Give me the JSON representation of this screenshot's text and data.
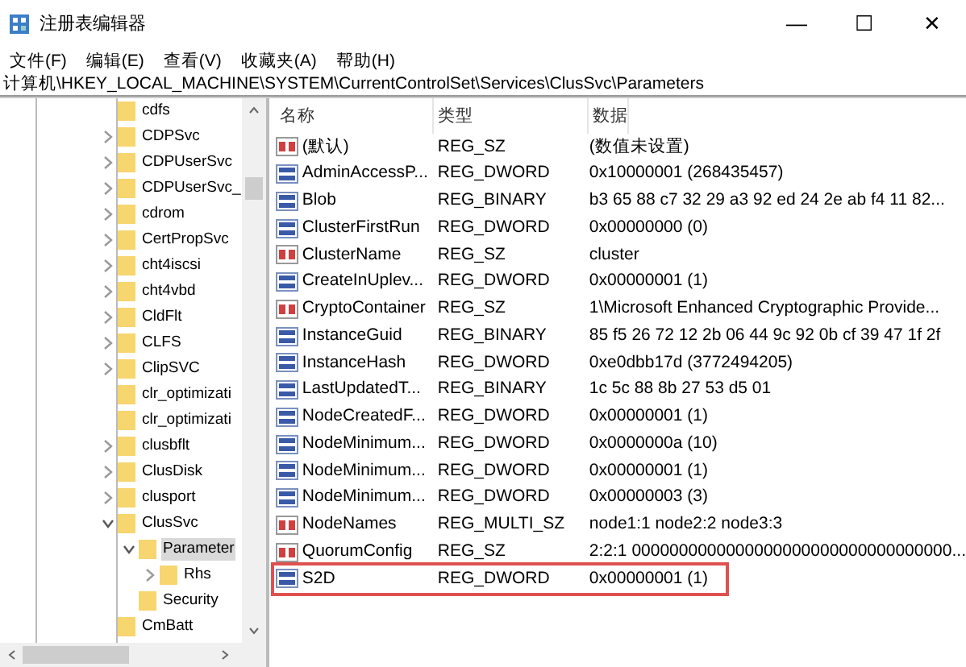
{
  "window": {
    "title": "注册表编辑器",
    "controls": [
      "—",
      "☐",
      "✕"
    ]
  },
  "menu": [
    "文件(F)",
    "编辑(E)",
    "查看(V)",
    "收藏夹(A)",
    "帮助(H)"
  ],
  "address": "计算机\\HKEY_LOCAL_MACHINE\\SYSTEM\\CurrentControlSet\\Services\\ClusSvc\\Parameters",
  "tree": [
    {
      "label": "cdfs",
      "expandable": false,
      "selected": false
    },
    {
      "label": "CDPSvc",
      "expandable": true,
      "expanded": false,
      "selected": false
    },
    {
      "label": "CDPUserSvc",
      "expandable": true,
      "expanded": false,
      "selected": false
    },
    {
      "label": "CDPUserSvc_",
      "expandable": true,
      "expanded": false,
      "selected": false
    },
    {
      "label": "cdrom",
      "expandable": true,
      "expanded": false,
      "selected": false
    },
    {
      "label": "CertPropSvc",
      "expandable": true,
      "expanded": false,
      "selected": false
    },
    {
      "label": "cht4iscsi",
      "expandable": true,
      "expanded": false,
      "selected": false
    },
    {
      "label": "cht4vbd",
      "expandable": true,
      "expanded": false,
      "selected": false
    },
    {
      "label": "CldFlt",
      "expandable": true,
      "expanded": false,
      "selected": false
    },
    {
      "label": "CLFS",
      "expandable": true,
      "expanded": false,
      "selected": false
    },
    {
      "label": "ClipSVC",
      "expandable": true,
      "expanded": false,
      "selected": false
    },
    {
      "label": "clr_optimizati",
      "expandable": false,
      "selected": false
    },
    {
      "label": "clr_optimizati",
      "expandable": false,
      "selected": false
    },
    {
      "label": "clusbflt",
      "expandable": true,
      "expanded": false,
      "selected": false
    },
    {
      "label": "ClusDisk",
      "expandable": true,
      "expanded": false,
      "selected": false
    },
    {
      "label": "clusport",
      "expandable": true,
      "expanded": false,
      "selected": false
    },
    {
      "label": "ClusSvc",
      "expandable": true,
      "expanded": true,
      "selected": false,
      "children": [
        {
          "label": "Parameter",
          "expandable": true,
          "expanded": true,
          "selected": true,
          "children": [
            {
              "label": "Rhs",
              "expandable": true,
              "expanded": false,
              "selected": false
            }
          ]
        },
        {
          "label": "Security",
          "expandable": false,
          "selected": false
        }
      ]
    },
    {
      "label": "CmBatt",
      "expandable": false,
      "selected": false
    }
  ],
  "columns": [
    "名称",
    "类型",
    "数据"
  ],
  "values": [
    {
      "kind": "string",
      "name": "(默认)",
      "type": "REG_SZ",
      "data": "(数值未设置)",
      "highlighted": false
    },
    {
      "kind": "binary",
      "name": "AdminAccessP...",
      "type": "REG_DWORD",
      "data": "0x10000001 (268435457)",
      "highlighted": false
    },
    {
      "kind": "binary",
      "name": "Blob",
      "type": "REG_BINARY",
      "data": "b3 65 88 c7 32 29 a3 92 ed 24 2e ab f4 11 82...",
      "highlighted": false
    },
    {
      "kind": "binary",
      "name": "ClusterFirstRun",
      "type": "REG_DWORD",
      "data": "0x00000000 (0)",
      "highlighted": false
    },
    {
      "kind": "string",
      "name": "ClusterName",
      "type": "REG_SZ",
      "data": "cluster",
      "highlighted": false
    },
    {
      "kind": "binary",
      "name": "CreateInUplev...",
      "type": "REG_DWORD",
      "data": "0x00000001 (1)",
      "highlighted": false
    },
    {
      "kind": "string",
      "name": "CryptoContainer",
      "type": "REG_SZ",
      "data": "1\\Microsoft Enhanced Cryptographic Provide...",
      "highlighted": false
    },
    {
      "kind": "binary",
      "name": "InstanceGuid",
      "type": "REG_BINARY",
      "data": "85 f5 26 72 12 2b 06 44 9c 92 0b cf 39 47 1f 2f",
      "highlighted": false
    },
    {
      "kind": "binary",
      "name": "InstanceHash",
      "type": "REG_DWORD",
      "data": "0xe0dbb17d (3772494205)",
      "highlighted": false
    },
    {
      "kind": "binary",
      "name": "LastUpdatedT...",
      "type": "REG_BINARY",
      "data": "1c 5c 88 8b 27 53 d5 01",
      "highlighted": false
    },
    {
      "kind": "binary",
      "name": "NodeCreatedF...",
      "type": "REG_DWORD",
      "data": "0x00000001 (1)",
      "highlighted": false
    },
    {
      "kind": "binary",
      "name": "NodeMinimum...",
      "type": "REG_DWORD",
      "data": "0x0000000a (10)",
      "highlighted": false
    },
    {
      "kind": "binary",
      "name": "NodeMinimum...",
      "type": "REG_DWORD",
      "data": "0x00000001 (1)",
      "highlighted": false
    },
    {
      "kind": "binary",
      "name": "NodeMinimum...",
      "type": "REG_DWORD",
      "data": "0x00000003 (3)",
      "highlighted": false
    },
    {
      "kind": "string",
      "name": "NodeNames",
      "type": "REG_MULTI_SZ",
      "data": "node1:1 node2:2 node3:3",
      "highlighted": false
    },
    {
      "kind": "string",
      "name": "QuorumConfig",
      "type": "REG_SZ",
      "data": "2:2:1 0000000000000000000000000000000000...",
      "highlighted": false
    },
    {
      "kind": "binary",
      "name": "S2D",
      "type": "REG_DWORD",
      "data": "0x00000001 (1)",
      "highlighted": true
    }
  ]
}
